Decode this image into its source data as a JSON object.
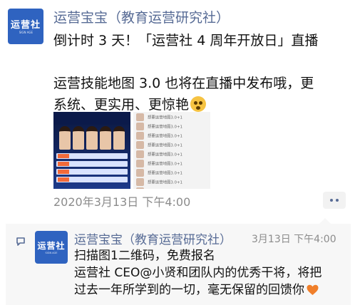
{
  "post": {
    "author": "运营宝宝（教育运营研究社）",
    "avatar": {
      "brand": "运营社",
      "sub": "SIGN AGE"
    },
    "text_lines": [
      "倒计时 3 天！「运营社 4 周年开放日」直播",
      "运营技能地图 3.0 也将在直播中发布哦，更",
      "系统、更实用、更惊艳"
    ],
    "emoji": "flushed-face-icon",
    "images": {
      "list_item_label": "想要运营地图3.0+1",
      "list_count": 9
    },
    "timestamp": "2020年3月13日 下午4:00"
  },
  "comment": {
    "author": "运营宝宝（教育运营研究社）",
    "avatar": {
      "brand": "运营社",
      "sub": "SIGN AGE"
    },
    "time": "3月13日 下午4:00",
    "text_lines": [
      "扫描图1二维码，免费报名",
      "运营社 CEO@小贤和团队内的优秀干将，将把",
      "过去一年所学到的一切，毫无保留的回馈你"
    ],
    "emoji": "orange-heart-icon"
  },
  "colors": {
    "link": "#576b95",
    "text": "#111111",
    "muted": "#8c8c8c",
    "comment_bg": "#f7f7f7",
    "avatar_bg": "#2f63c0",
    "heart": "#f07f2a"
  }
}
